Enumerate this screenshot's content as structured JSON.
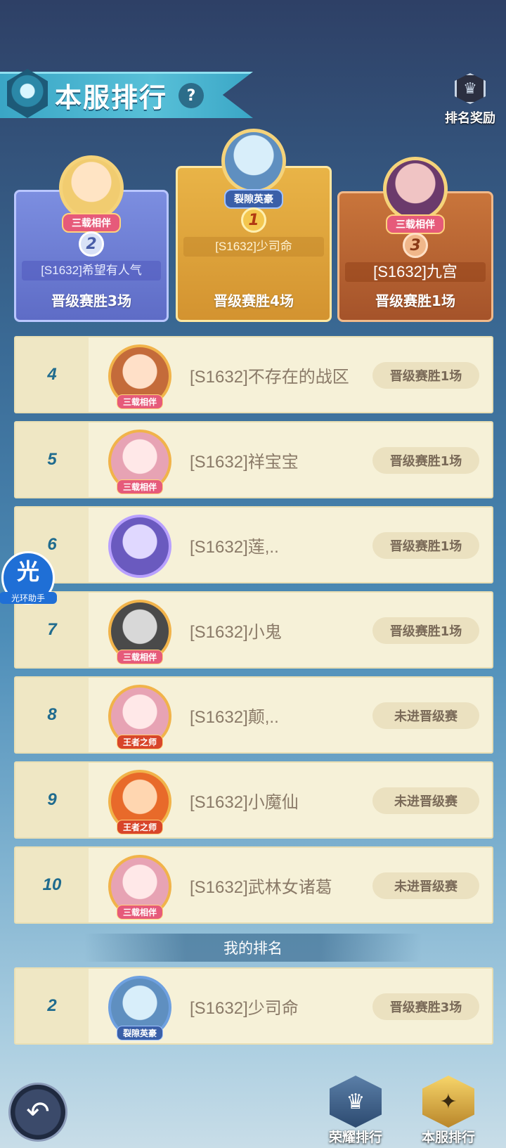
{
  "header": {
    "title": "本服排行",
    "help": "?",
    "reward_label": "排名奖励"
  },
  "podium": [
    {
      "rank": "2",
      "name": "[S1632]希望有人气",
      "badge": "三载相伴",
      "wins": "晋级赛胜3场"
    },
    {
      "rank": "1",
      "name": "[S1632]少司命",
      "badge": "裂隙英豪",
      "wins": "晋级赛胜4场"
    },
    {
      "rank": "3",
      "name": "[S1632]九宫",
      "badge": "三载相伴",
      "wins": "晋级赛胜1场"
    }
  ],
  "list": [
    {
      "rank": "4",
      "name": "[S1632]不存在的战区",
      "tag": "三载相伴",
      "status": "晋级赛胜1场"
    },
    {
      "rank": "5",
      "name": "[S1632]祥宝宝",
      "tag": "三载相伴",
      "status": "晋级赛胜1场"
    },
    {
      "rank": "6",
      "name": "[S1632]莲,..",
      "tag": "",
      "status": "晋级赛胜1场"
    },
    {
      "rank": "7",
      "name": "[S1632]小鬼",
      "tag": "三载相伴",
      "status": "晋级赛胜1场"
    },
    {
      "rank": "8",
      "name": "[S1632]颠,..",
      "tag": "王者之师",
      "status": "未进晋级赛"
    },
    {
      "rank": "9",
      "name": "[S1632]小魔仙",
      "tag": "王者之师",
      "status": "未进晋级赛"
    },
    {
      "rank": "10",
      "name": "[S1632]武林女诸葛",
      "tag": "三载相伴",
      "status": "未进晋级赛"
    }
  ],
  "my_rank": {
    "label": "我的排名",
    "rank": "2",
    "name": "[S1632]少司命",
    "tag": "裂隙英豪",
    "status": "晋级赛胜3场"
  },
  "assistant": {
    "glyph": "光",
    "label": "光环助手"
  },
  "bottom": {
    "back": "↶",
    "honor_label": "荣耀排行",
    "server_label": "本服排行"
  }
}
